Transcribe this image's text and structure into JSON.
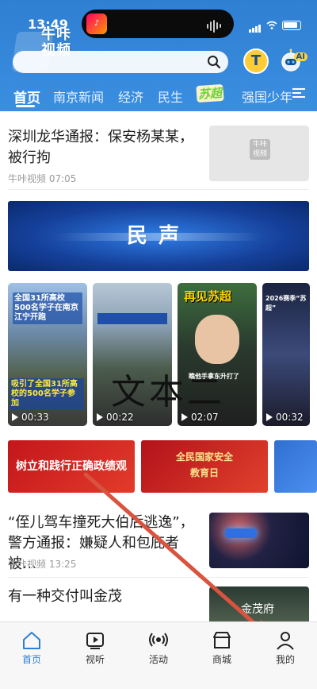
{
  "status_bar": {
    "time": "13:49"
  },
  "header": {
    "logo_text_1": "牛咔",
    "logo_text_2": "视频",
    "search_placeholder": "",
    "t_icon": "T",
    "ai_label": "AI",
    "tabs": [
      "首页",
      "南京新闻",
      "经济",
      "民生",
      "苏超",
      "强国少年"
    ],
    "active_tab": "首页",
    "menu_icon": "menu-icon"
  },
  "news": [
    {
      "title": "深圳龙华通报：保安杨某某，被行拘",
      "source": "牛咔视频",
      "time": "07:05",
      "thumb_text_1": "牛咔",
      "thumb_text_2": "视频"
    },
    {
      "title": "“侄儿驾车撞死大伯后逃逸”，警方通报：嫌疑人和包庇者被…",
      "source": "牛咔视频",
      "time": "13:25"
    },
    {
      "title": "有一种交付叫金茂",
      "thumb_text": "金茂府"
    }
  ],
  "minsheng_banner": {
    "text": "民声"
  },
  "videos": [
    {
      "duration": "00:33",
      "caption_top": "全国31所高校500名学子在南京江宁开跑",
      "caption_bottom": "吸引了全国31所高校的500名学子参加"
    },
    {
      "duration": "00:22",
      "caption_top": ""
    },
    {
      "duration": "02:07",
      "caption_top": "再见苏超",
      "caption_bottom": "瞧他手拿东升打了"
    },
    {
      "duration": "00:32",
      "caption_top": "2026赛季“苏超”"
    }
  ],
  "overlay_text": "文本二",
  "banners": [
    {
      "text": "树立和践行正确政绩观"
    },
    {
      "text_1": "全民国家安全",
      "text_2": "教育日"
    },
    {
      "text": ""
    }
  ],
  "tabbar": [
    {
      "label": "首页",
      "icon": "home-icon",
      "active": true
    },
    {
      "label": "视听",
      "icon": "play-icon",
      "active": false
    },
    {
      "label": "活动",
      "icon": "broadcast-icon",
      "active": false
    },
    {
      "label": "商城",
      "icon": "shop-icon",
      "active": false
    },
    {
      "label": "我的",
      "icon": "profile-icon",
      "active": false
    }
  ],
  "colors": {
    "header_blue": "#2f7fd3",
    "active_tab": "#2f7fd3",
    "arrow_red": "#d9533f"
  }
}
